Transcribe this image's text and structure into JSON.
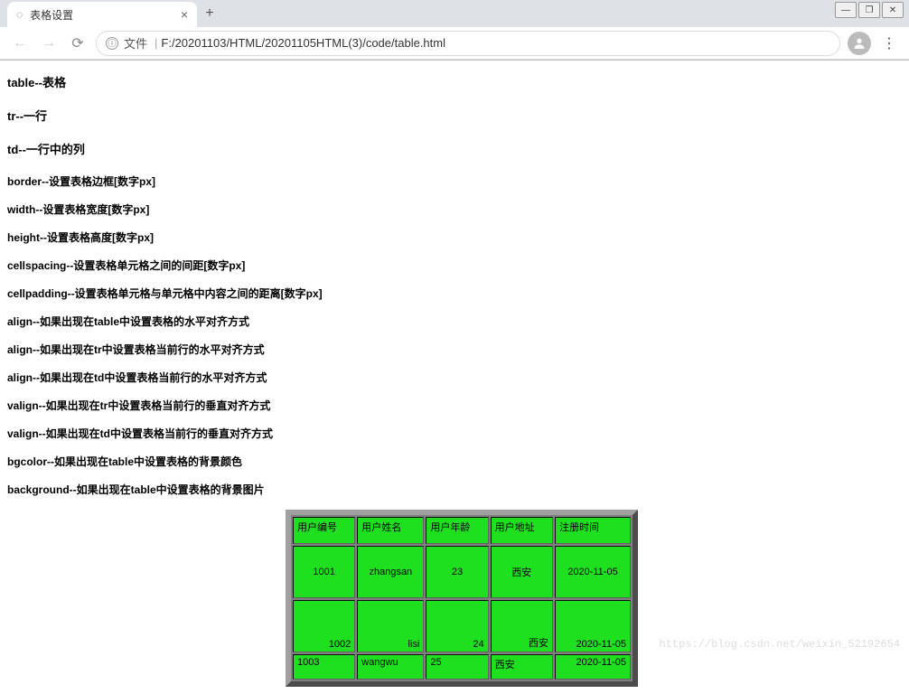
{
  "browser": {
    "tab_title": "表格设置",
    "url_label": "文件",
    "url": "F:/20201103/HTML/20201105HTML(3)/code/table.html",
    "info_glyph": "ⓘ"
  },
  "descriptions": {
    "big": [
      "table--表格",
      "tr--一行",
      "td--一行中的列"
    ],
    "small": [
      "border--设置表格边框[数字px]",
      "width--设置表格宽度[数字px]",
      "height--设置表格高度[数字px]",
      "cellspacing--设置表格单元格之间的间距[数字px]",
      "cellpadding--设置表格单元格与单元格中内容之间的距离[数字px]",
      "align--如果出现在table中设置表格的水平对齐方式",
      "align--如果出现在tr中设置表格当前行的水平对齐方式",
      "align--如果出现在td中设置表格当前行的水平对齐方式",
      "valign--如果出现在tr中设置表格当前行的垂直对齐方式",
      "valign--如果出现在td中设置表格当前行的垂直对齐方式",
      "bgcolor--如果出现在table中设置表格的背景颜色",
      "background--如果出现在table中设置表格的背景图片"
    ]
  },
  "table": {
    "headers": [
      "用户编号",
      "用户姓名",
      "用户年龄",
      "用户地址",
      "注册时间"
    ],
    "rows": [
      {
        "id": "1001",
        "name": "zhangsan",
        "age": "23",
        "addr": "西安",
        "date": "2020-11-05"
      },
      {
        "id": "1002",
        "name": "lisi",
        "age": "24",
        "addr": "西安",
        "date": "2020-11-05"
      },
      {
        "id": "1003",
        "name": "wangwu",
        "age": "25",
        "addr": "西安",
        "date": "2020-11-05"
      }
    ],
    "bgcolor": "#1fe01f"
  },
  "watermark": "https://blog.csdn.net/weixin_52192654"
}
